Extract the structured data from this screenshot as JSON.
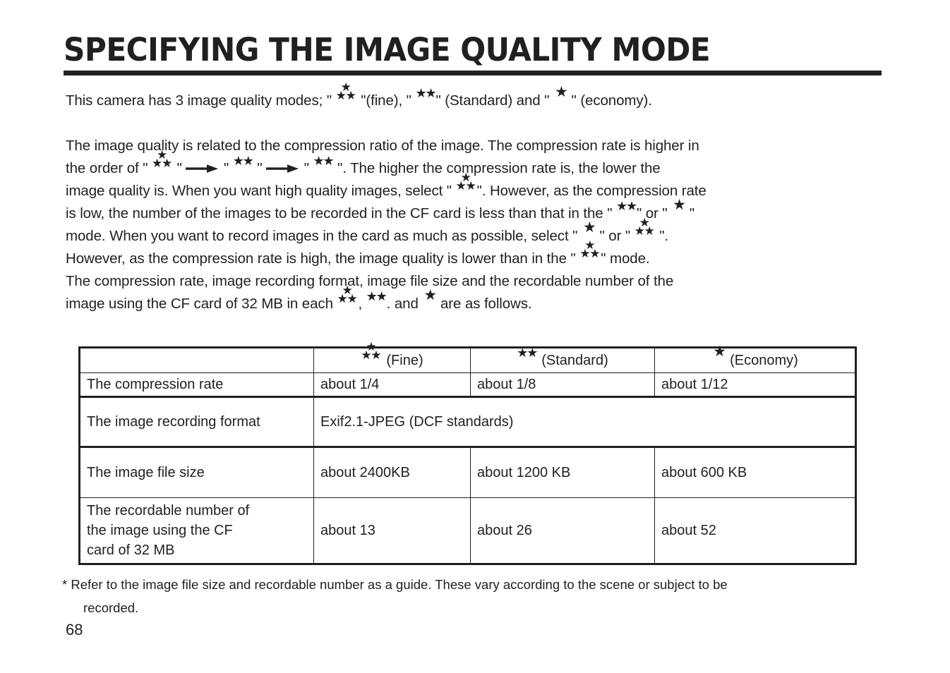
{
  "document": {
    "title": "SPECIFYING THE IMAGE QUALITY MODE",
    "page_number": "68"
  },
  "icons": {
    "fine": "three-star-icon",
    "standard": "two-star-icon",
    "economy": "one-star-icon",
    "arrow": "right-arrow-icon",
    "star_glyph": "★"
  },
  "intro_paragraph": {
    "seg_1": "This camera has 3 image quality modes; \" ",
    "seg_2": " \"(fine), \" ",
    "seg_3": "\" (Standard) and \" ",
    "seg_4": " \" (economy)."
  },
  "detail_paragraph": {
    "line1": "The image quality is related to the compression ratio of the image. The compression rate is higher in",
    "line2_a": "the order of \" ",
    "line2_b": " \" ",
    "line2_c": " \" ",
    "line2_d": " \" ",
    "line2_e": " \" ",
    "line2_f": " \". The higher the compression rate is, the lower the",
    "line3_a": "image quality is. When you want high quality images, select \" ",
    "line3_b": "\". However, as the compression rate",
    "line4_a": "is low, the number of the images to be recorded in the CF card is less than that in the \" ",
    "line4_b": "\" or \" ",
    "line4_c": " \"",
    "line5_a": "mode. When you want to record images in the card as much as possible, select \" ",
    "line5_b": " \" or \" ",
    "line5_c": " \".",
    "line6_a": "However, as the compression rate is high, the image quality is lower than in the \" ",
    "line6_b": "\" mode.",
    "line7": "The compression rate, image recording format, image file size and the recordable number of the",
    "line8_a": "image using the CF card of 32 MB in each ",
    "line8_b": ", ",
    "line8_c": ". and ",
    "line8_d": " are as follows."
  },
  "table": {
    "headers": {
      "label_column": "",
      "fine": "(Fine)",
      "standard": "(Standard)",
      "economy": "(Economy)"
    },
    "rows": [
      {
        "label": "The compression rate",
        "fine": "about 1/4",
        "standard": "about 1/8",
        "economy": "about 1/12"
      },
      {
        "label": "The image recording format",
        "spanned_value": "Exif2.1-JPEG (DCF standards)"
      },
      {
        "label": "The image file size",
        "fine": "about 2400KB",
        "standard": "about 1200 KB",
        "economy": "about 600 KB"
      },
      {
        "label_line1": "The recordable number of",
        "label_line2": "the image using the CF",
        "label_line3": "card of  32  MB",
        "fine": "about 13",
        "standard": "about 26",
        "economy": "about 52"
      }
    ]
  },
  "footnote": {
    "line1": "*  Refer to the image file size and recordable number as a guide. These vary according to the scene or subject to be",
    "line2": "recorded."
  },
  "colors": {
    "ink": "#231f20",
    "paper": "#ffffff"
  }
}
